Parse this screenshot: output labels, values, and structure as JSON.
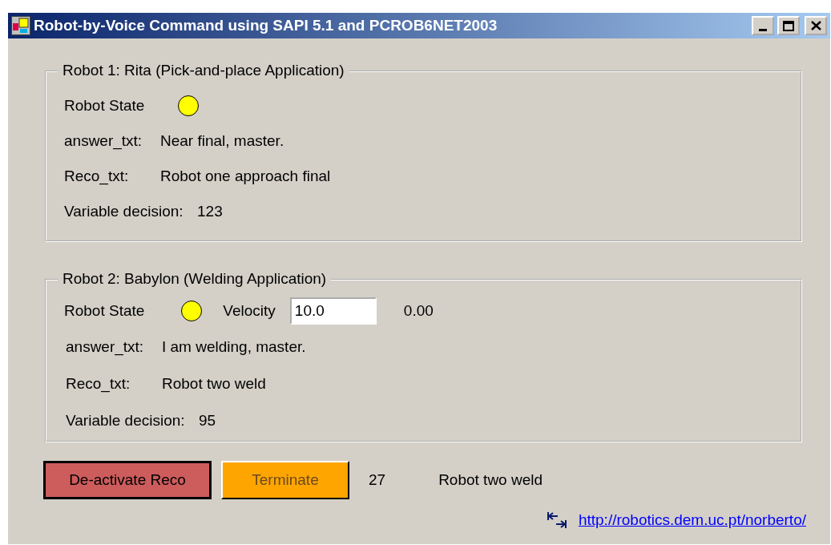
{
  "window": {
    "title": "Robot-by-Voice Command using SAPI 5.1 and PCROB6NET2003",
    "controls": [
      {
        "kind": "minimize"
      },
      {
        "kind": "maximize"
      },
      {
        "kind": "close"
      }
    ]
  },
  "robots": [
    {
      "legend": "Robot 1:  Rita (Pick-and-place Application)",
      "state_label": "Robot State",
      "color": "#ffff00",
      "fields": [
        {
          "label": "answer_txt:",
          "value": "Near final, master."
        },
        {
          "label": "Reco_txt:",
          "value": "Robot one approach final"
        },
        {
          "label": "Variable decision:",
          "value": "123"
        }
      ]
    },
    {
      "legend": "Robot 2:  Babylon (Welding Application)",
      "state_label": "Robot State",
      "color": "#ffff00",
      "velocity": {
        "label": "Velocity",
        "value": "10.0",
        "reading": "0.00"
      },
      "fields": [
        {
          "label": "answer_txt:",
          "value": "I am welding, master."
        },
        {
          "label": "Reco_txt:",
          "value": "Robot two weld"
        },
        {
          "label": "Variable decision:",
          "value": "95"
        }
      ]
    }
  ],
  "buttons": [
    {
      "label": "De-activate Reco",
      "color": "#cd5c5c",
      "disabled": false
    },
    {
      "label": "Terminate",
      "color": "#ffa500",
      "disabled": true
    }
  ],
  "count": "27",
  "last_reco": "Robot two weld",
  "link": "http://robotics.dem.uc.pt/norberto/"
}
